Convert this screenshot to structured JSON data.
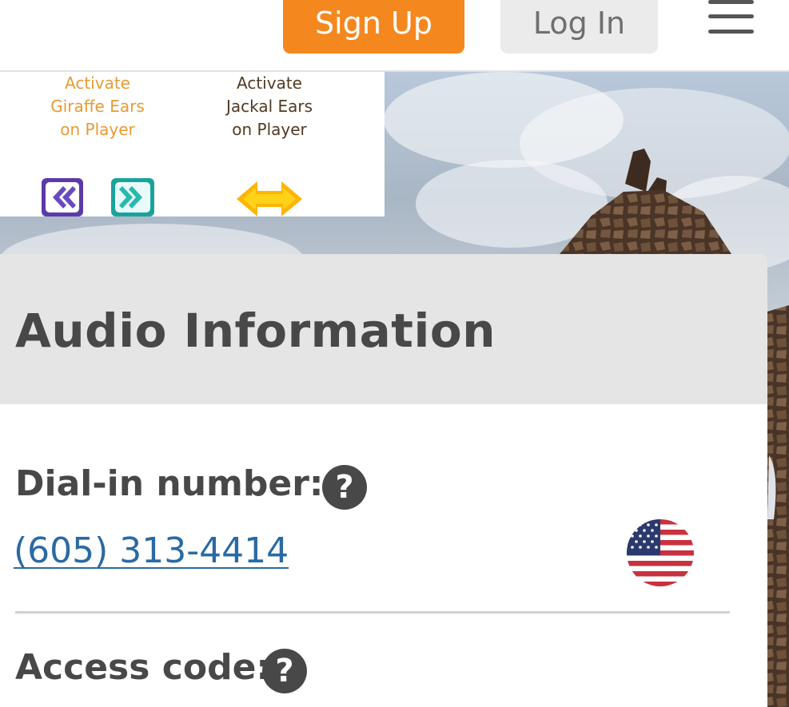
{
  "header": {
    "signup_label": "Sign Up",
    "login_label": "Log In",
    "menu_icon": "hamburger-menu-icon",
    "signup_color": "#f5871f"
  },
  "promo": {
    "left_caption": "Activate\nGiraffe Ears\non Player",
    "right_caption": "Activate\nJackal Ears\non Player",
    "icons": [
      "rewind-icon",
      "fast-forward-icon",
      "double-arrow-icon"
    ]
  },
  "card": {
    "title": "Audio Information",
    "dial_in_label": "Dial-in number:",
    "dial_in_number": "(605) 313-4414",
    "country_icon": "us-flag-icon",
    "access_code_label": "Access code:",
    "help_glyph": "?",
    "link_color": "#2a6aa3"
  }
}
